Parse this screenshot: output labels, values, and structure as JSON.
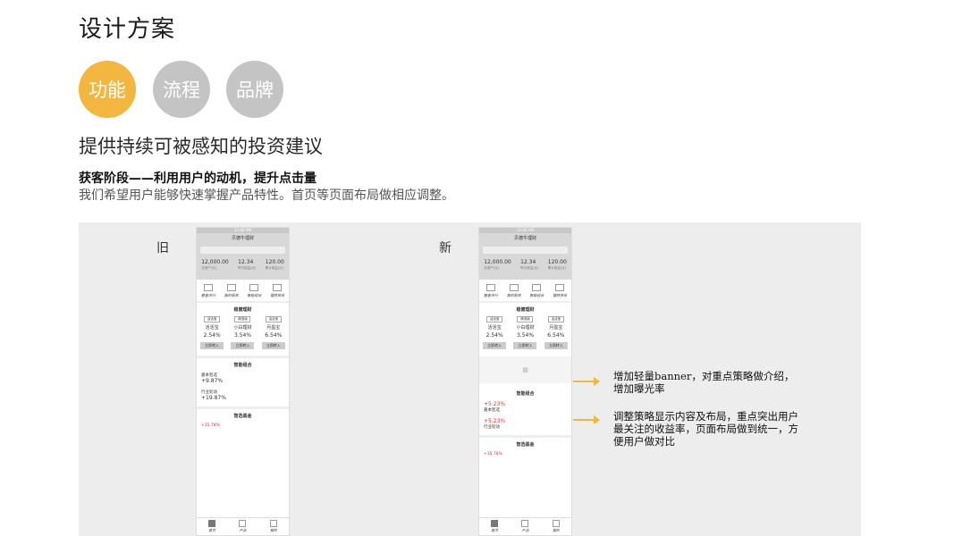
{
  "title": "设计方案",
  "circles": [
    "功能",
    "流程",
    "品牌"
  ],
  "headline": "提供持续可被感知的投资建议",
  "subtitle": "获客阶段——利用用户的动机，提升点击量",
  "description": "我们希望用户能够快速掌握产品特性。首页等页面布局做相应调整。",
  "labels": {
    "old": "旧",
    "new": "新"
  },
  "phone": {
    "app_title": "贝德牛理财",
    "stats": [
      {
        "value": "12,000.00",
        "label": "总资产(元)"
      },
      {
        "value": "12.34",
        "label": "昨日收益(元)"
      },
      {
        "value": "120.00",
        "label": "累计收益(元)"
      }
    ],
    "icons": [
      "基金市行",
      "我的投资",
      "智能组合",
      "理财资讯"
    ],
    "section1_title": "稳健理财",
    "products": [
      {
        "tag": "活活宝",
        "name": "活活宝",
        "pct": "2.54%",
        "btn": "立即转入"
      },
      {
        "tag": "精选版",
        "name": "小白理财",
        "pct": "3.54%",
        "btn": "立即转入"
      },
      {
        "tag": "活活宝",
        "name": "月盈宝",
        "pct": "6.54%",
        "btn": "立即转入"
      }
    ],
    "section2_title": "智能组合",
    "old_combos": [
      {
        "name": "嘉本智选",
        "rate": "+9.87%"
      },
      {
        "name": "行业轮动",
        "rate": "+19.87%"
      }
    ],
    "new_combos": [
      {
        "name": "嘉本智选",
        "rate": "+5.23%"
      },
      {
        "name": "行业轮动",
        "rate": "+5.23%"
      }
    ],
    "section3_title": "智选基金",
    "fund_rate": "+35.78%",
    "tabs": [
      "首页",
      "产品",
      "我的"
    ]
  },
  "notes": [
    "增加轻量banner，对重点策略做介绍，增加曝光率",
    "调整策略显示内容及布局，重点突出用户最关注的收益率，页面布局做到统一，方便用户做对比"
  ]
}
